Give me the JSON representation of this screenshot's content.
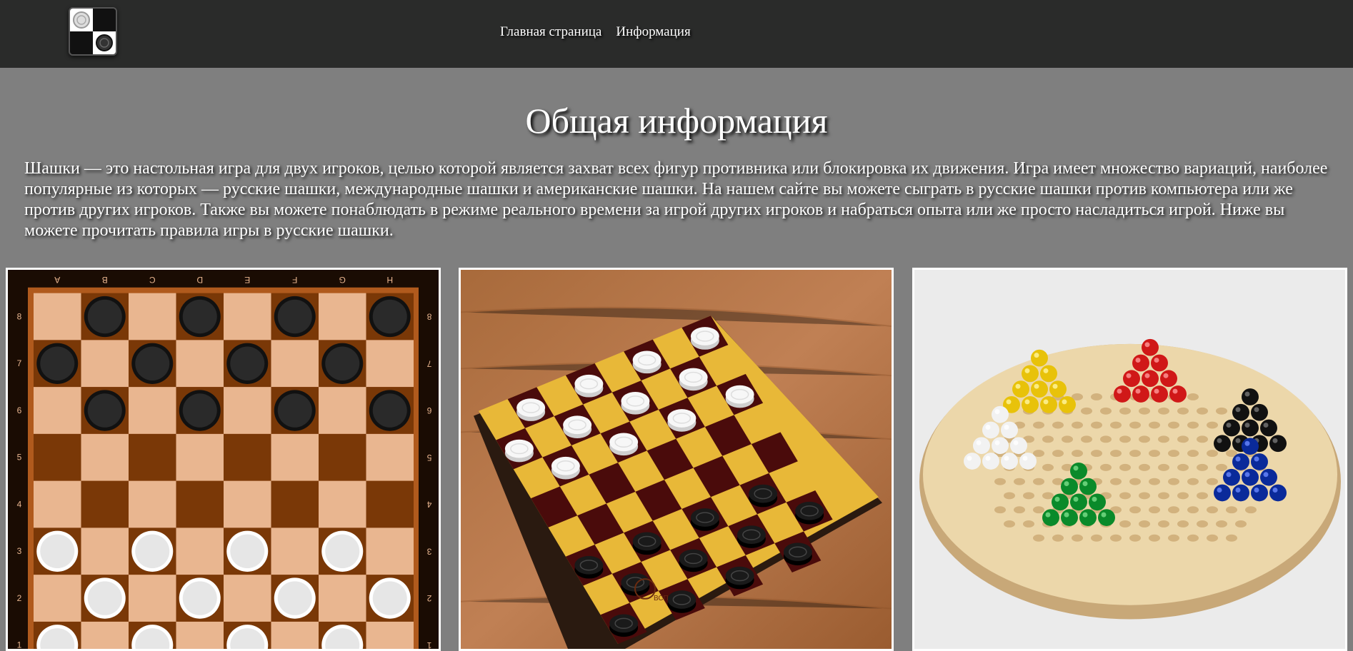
{
  "header": {
    "logo_icon": "checkers-logo-icon",
    "nav": [
      {
        "label": "Главная страница"
      },
      {
        "label": "Информация"
      }
    ]
  },
  "main": {
    "title": "Общая информация",
    "description": "Шашки — это настольная игра для двух игроков, целью которой является захват всех фигур противника или блокировка их движения. Игра имеет множество вариаций, наиболее популярные из которых — русские шашки, международные шашки и американские шашки. На нашем сайте вы можете сыграть в русские шашки против компьютера или же против других игроков. Также вы можете понаблюдать в режиме реального времени за игрой других игроков и набраться опыта или же просто насладиться игрой. Ниже вы можете прочитать правила игры в русские шашки."
  },
  "images": {
    "board_files": [
      "A",
      "B",
      "C",
      "D",
      "E",
      "F",
      "G",
      "H"
    ],
    "board_ranks": [
      "8",
      "7",
      "6",
      "5",
      "4",
      "3",
      "2",
      "1"
    ],
    "photo_brand": "ВСП"
  },
  "colors": {
    "header_bg": "#2a2b2a",
    "page_bg": "#7f7f7f",
    "board_light": "#e9b690",
    "board_dark": "#7a3807",
    "board_frame": "#1a0c03"
  }
}
